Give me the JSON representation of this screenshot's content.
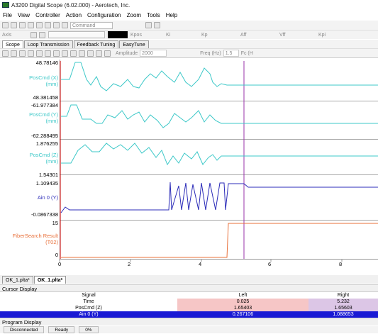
{
  "app": {
    "title": "A3200 Digital Scope (6.02.000) - Aerotech, Inc."
  },
  "menu": [
    "File",
    "View",
    "Controller",
    "Action",
    "Configuration",
    "Zoom",
    "Tools",
    "Help"
  ],
  "toolbar1": {
    "command_placeholder": "Command"
  },
  "toolbar2": {
    "axis_label": "Axis",
    "kpos": "Kpos",
    "ki": "Ki",
    "kp": "Kp",
    "aff": "Aff",
    "vff": "Vff",
    "kpi": "Kpi"
  },
  "tabs": [
    "Scope",
    "Loop Transmission",
    "Feedback Tuning",
    "EasyTune"
  ],
  "toolbar3": {
    "amplitude_label": "Amplitude",
    "amplitude_value": "2000",
    "freq_label": "Freq (Hz)",
    "freq_value": "1.5",
    "fc_label": "Fc (H"
  },
  "plot": {
    "traces": [
      {
        "name": "PosCmd (X)",
        "unit": "(mm)",
        "max": "48.78146",
        "min": "48.381458",
        "color": "#3cc8c8"
      },
      {
        "name": "PosCmd (Y)",
        "unit": "(mm)",
        "max": "-61.977384",
        "min": "-62.288495",
        "color": "#3cc8c8"
      },
      {
        "name": "PosCmd (Z)",
        "unit": "(mm)",
        "max": "1.876255",
        "min": "1.54301",
        "color": "#3cc8c8"
      },
      {
        "name": "Ain 0 (Y)",
        "unit": "",
        "max": "1.109435",
        "min": "-0.0867338",
        "color": "#2b2bb8"
      },
      {
        "name": "FiberSearch Result (T02)",
        "unit": "",
        "max": "15",
        "min": "0",
        "color": "#e8703a"
      }
    ],
    "x_ticks": [
      "0",
      "2",
      "4",
      "6",
      "8"
    ],
    "cursor_left_color": "#cc0000",
    "cursor_right_color": "#9933aa"
  },
  "bottom_tabs": [
    "OK_1.plta*",
    "OK_1.plta*"
  ],
  "cursor_display": {
    "title": "Cursor Display",
    "headers": [
      "Signal",
      "Left",
      "Right"
    ],
    "rows": [
      [
        "Time",
        "0.025",
        "5.232"
      ],
      [
        "PosCmd (Z)",
        "1.65403",
        "1.65603"
      ],
      [
        "Ain 0 (Y)",
        "0.267106",
        "1.088653"
      ]
    ]
  },
  "program_display": {
    "title": "Program Display"
  },
  "status": [
    "Disconnected",
    "Ready",
    "0%"
  ]
}
